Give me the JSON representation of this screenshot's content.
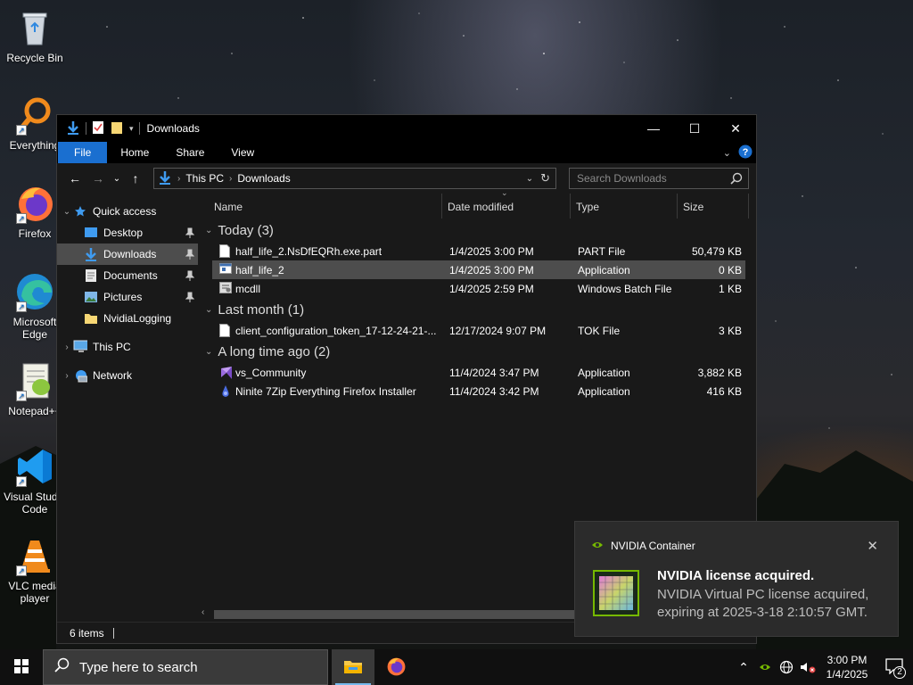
{
  "desktop": {
    "icons": [
      {
        "label": "Recycle Bin"
      },
      {
        "label": "Everything"
      },
      {
        "label": "Firefox"
      },
      {
        "label": "Microsoft Edge"
      },
      {
        "label": "Notepad++"
      },
      {
        "label": "Visual Studio Code"
      },
      {
        "label": "VLC media player"
      }
    ]
  },
  "window": {
    "title": "Downloads",
    "controls": {
      "minimize": "—",
      "maximize": "☐",
      "close": "✕"
    },
    "ribbon_tabs": [
      "File",
      "Home",
      "Share",
      "View"
    ],
    "address": {
      "segments": [
        "This PC",
        "Downloads"
      ]
    },
    "search": {
      "placeholder": "Search Downloads"
    },
    "nav_pane": {
      "quick_access": "Quick access",
      "items": [
        {
          "label": "Desktop",
          "pinned": true
        },
        {
          "label": "Downloads",
          "pinned": true,
          "selected": true
        },
        {
          "label": "Documents",
          "pinned": true
        },
        {
          "label": "Pictures",
          "pinned": true
        },
        {
          "label": "NvidiaLogging",
          "pinned": false
        }
      ],
      "this_pc": "This PC",
      "network": "Network"
    },
    "columns": {
      "name": "Name",
      "date": "Date modified",
      "type": "Type",
      "size": "Size"
    },
    "groups": [
      {
        "label": "Today (3)",
        "files": [
          {
            "name": "half_life_2.NsDfEQRh.exe.part",
            "date": "1/4/2025 3:00 PM",
            "type": "PART File",
            "size": "50,479 KB",
            "icon": "document-icon"
          },
          {
            "name": "half_life_2",
            "date": "1/4/2025 3:00 PM",
            "type": "Application",
            "size": "0 KB",
            "icon": "application-icon"
          },
          {
            "name": "mcdll",
            "date": "1/4/2025 2:59 PM",
            "type": "Windows Batch File",
            "size": "1 KB",
            "icon": "batch-file-icon"
          }
        ]
      },
      {
        "label": "Last month (1)",
        "files": [
          {
            "name": "client_configuration_token_17-12-24-21-...",
            "date": "12/17/2024 9:07 PM",
            "type": "TOK File",
            "size": "3 KB",
            "icon": "document-icon"
          }
        ]
      },
      {
        "label": "A long time ago (2)",
        "files": [
          {
            "name": "vs_Community",
            "date": "11/4/2024 3:47 PM",
            "type": "Application",
            "size": "3,882 KB",
            "icon": "visual-studio-icon"
          },
          {
            "name": "Ninite 7Zip Everything Firefox Installer",
            "date": "11/4/2024 3:42 PM",
            "type": "Application",
            "size": "416 KB",
            "icon": "ninite-icon"
          }
        ]
      }
    ],
    "status": "6 items"
  },
  "toast": {
    "app": "NVIDIA Container",
    "title": "NVIDIA license acquired.",
    "message": "NVIDIA Virtual PC license acquired, expiring at 2025-3-18 2:10:57 GMT."
  },
  "taskbar": {
    "search_placeholder": "Type here to search",
    "time": "3:00 PM",
    "date": "1/4/2025",
    "notification_count": "2"
  },
  "colors": {
    "accent": "#1a6fd0",
    "selection": "#4d4d4d",
    "nvidia_green": "#76b900"
  }
}
